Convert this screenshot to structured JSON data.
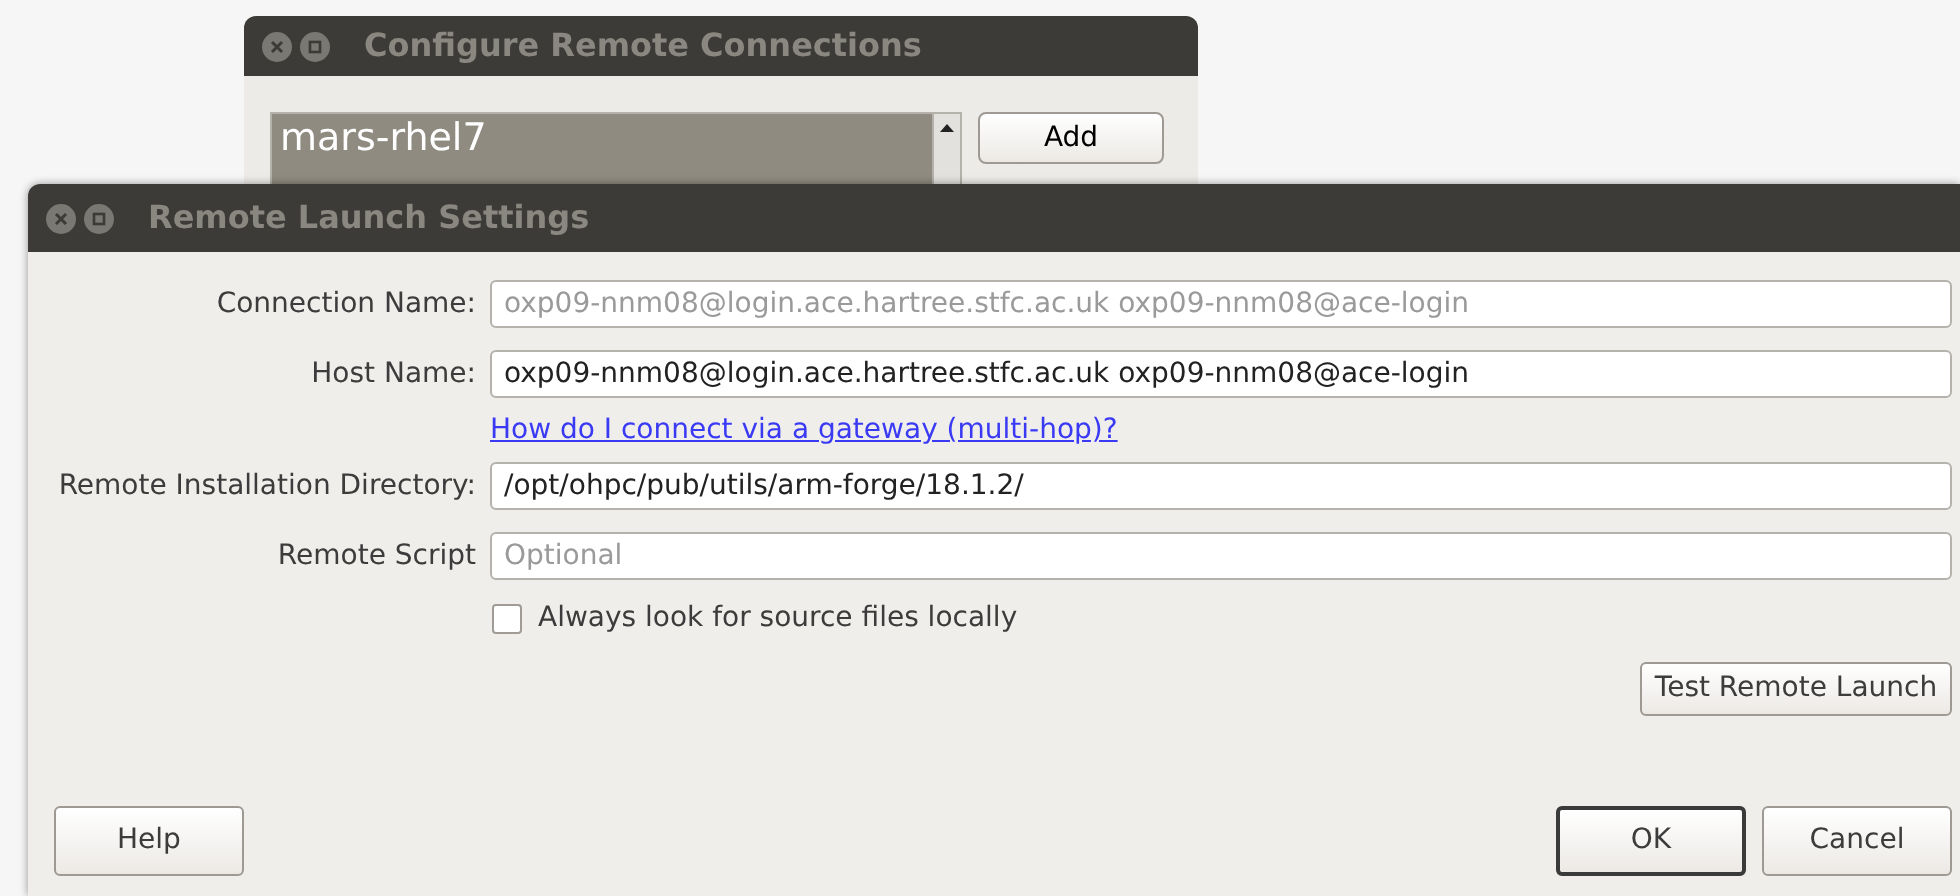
{
  "back_window": {
    "title": "Configure Remote Connections",
    "connections": [
      {
        "name": "mars-rhel7",
        "selected": true
      }
    ],
    "buttons": [
      "Add"
    ]
  },
  "window": {
    "title": "Remote Launch Settings"
  },
  "fields": [
    {
      "label": "Connection Name:",
      "placeholder": "oxp09-nnm08@login.ace.hartree.stfc.ac.uk oxp09-nnm08@ace-login"
    },
    {
      "label": "Host Name:",
      "value": "oxp09-nnm08@login.ace.hartree.stfc.ac.uk oxp09-nnm08@ace-login",
      "link": "How do I connect via a gateway (multi-hop)?"
    },
    {
      "label": "Remote Installation Directory:",
      "value": "/opt/ohpc/pub/utils/arm-forge/18.1.2/"
    },
    {
      "label": "Remote Script",
      "placeholder": "Optional"
    }
  ],
  "checkbox": {
    "label": "Always look for source files locally",
    "checked": false
  },
  "test_button": "Test Remote Launch",
  "buttons": [
    {
      "label": "Help",
      "default": false
    },
    {
      "label": "OK",
      "default": true
    },
    {
      "label": "Cancel",
      "default": false
    }
  ]
}
